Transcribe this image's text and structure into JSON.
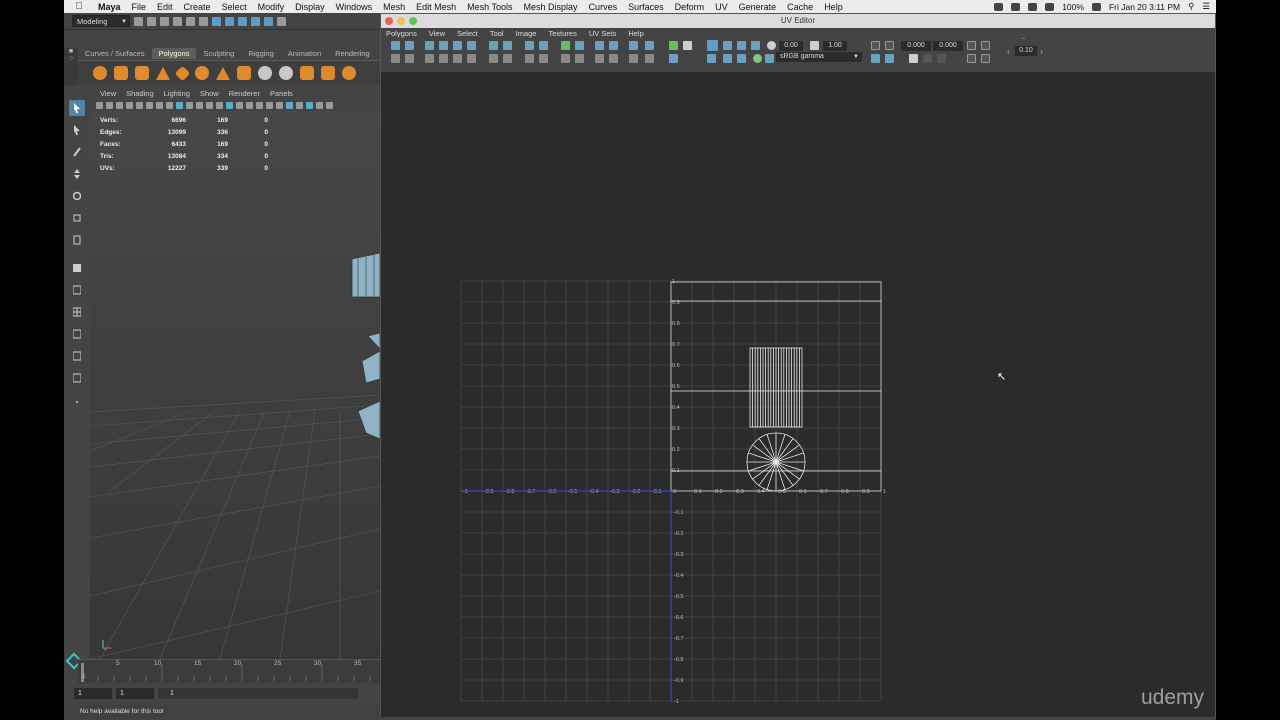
{
  "menubar": {
    "app": "Maya",
    "items": [
      "File",
      "Edit",
      "Create",
      "Select",
      "Modify",
      "Display",
      "Windows",
      "Mesh",
      "Edit Mesh",
      "Mesh Tools",
      "Mesh Display",
      "Curves",
      "Surfaces",
      "Deform",
      "UV",
      "Generate",
      "Cache",
      "Help"
    ],
    "battery": "100%",
    "clock": "Fri Jan 20  3:11 PM"
  },
  "status": {
    "mode": "Modeling"
  },
  "shelf": {
    "tabs": [
      "Curves / Surfaces",
      "Polygons",
      "Sculpting",
      "Rigging",
      "Animation",
      "Rendering"
    ],
    "active": "Polygons"
  },
  "viewport": {
    "menu": [
      "View",
      "Shading",
      "Lighting",
      "Show",
      "Renderer",
      "Panels"
    ],
    "hud": [
      {
        "k": "Verts:",
        "a": "6696",
        "b": "169",
        "c": "0"
      },
      {
        "k": "Edges:",
        "a": "13099",
        "b": "336",
        "c": "0"
      },
      {
        "k": "Faces:",
        "a": "6433",
        "b": "169",
        "c": "0"
      },
      {
        "k": "Tris:",
        "a": "13084",
        "b": "334",
        "c": "0"
      },
      {
        "k": "UVs:",
        "a": "12227",
        "b": "339",
        "c": "0"
      }
    ]
  },
  "timeslider": {
    "ticks": [
      "5",
      "10",
      "15",
      "20",
      "25",
      "30",
      "35"
    ],
    "start": "1",
    "current": "1",
    "range_label": "1"
  },
  "helpline": "No help available for this tool",
  "uv_editor": {
    "title": "UV Editor",
    "menu": [
      "Polygons",
      "Select",
      "View",
      "Tool",
      "Image",
      "Textures",
      "UV Sets",
      "Help"
    ],
    "fields": {
      "a": "0.00",
      "b": "1.00",
      "u": "0.000",
      "v": "0.000",
      "step": "0.10"
    },
    "color_space": "sRGB gamma",
    "x_ticks_neg": [
      "-1",
      "-0.9",
      "-0.8",
      "-0.7",
      "-0.6",
      "-0.5",
      "-0.4",
      "-0.3",
      "-0.2",
      "-0.1"
    ],
    "x_ticks_pos": [
      "0",
      "0.1",
      "0.2",
      "0.3",
      "0.4",
      "0.5",
      "0.6",
      "0.7",
      "0.8",
      "0.9",
      "1"
    ],
    "y_ticks_pos": [
      "1",
      "0.9",
      "0.8",
      "0.7",
      "0.6",
      "0.5",
      "0.4",
      "0.3",
      "0.2",
      "0.1"
    ],
    "y_ticks_neg": [
      "-0.1",
      "-0.2",
      "-0.3",
      "-0.4",
      "-0.5",
      "-0.6",
      "-0.7",
      "-0.8",
      "-0.9",
      "-1"
    ]
  },
  "watermark": "udemy"
}
